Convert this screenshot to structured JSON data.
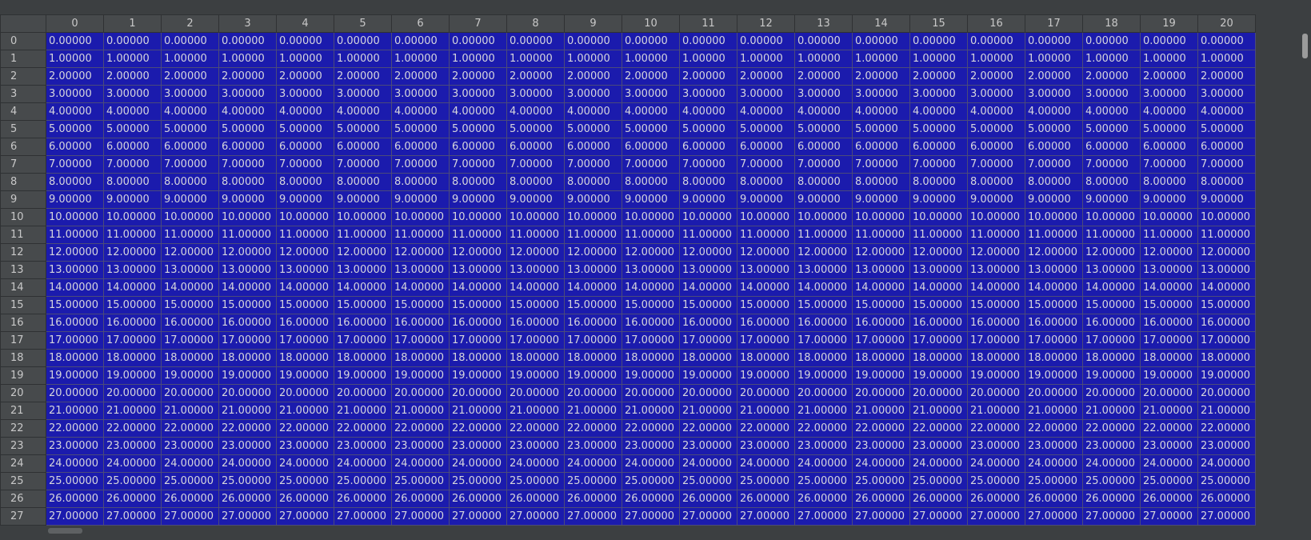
{
  "table": {
    "columns": [
      "0",
      "1",
      "2",
      "3",
      "4",
      "5",
      "6",
      "7",
      "8",
      "9",
      "10",
      "11",
      "12",
      "13",
      "14",
      "15",
      "16",
      "17",
      "18",
      "19",
      "20"
    ],
    "rows": [
      {
        "index": "0",
        "value": "0.00000"
      },
      {
        "index": "1",
        "value": "1.00000"
      },
      {
        "index": "2",
        "value": "2.00000"
      },
      {
        "index": "3",
        "value": "3.00000"
      },
      {
        "index": "4",
        "value": "4.00000"
      },
      {
        "index": "5",
        "value": "5.00000"
      },
      {
        "index": "6",
        "value": "6.00000"
      },
      {
        "index": "7",
        "value": "7.00000"
      },
      {
        "index": "8",
        "value": "8.00000"
      },
      {
        "index": "9",
        "value": "9.00000"
      },
      {
        "index": "10",
        "value": "10.00000"
      },
      {
        "index": "11",
        "value": "11.00000"
      },
      {
        "index": "12",
        "value": "12.00000"
      },
      {
        "index": "13",
        "value": "13.00000"
      },
      {
        "index": "14",
        "value": "14.00000"
      },
      {
        "index": "15",
        "value": "15.00000"
      },
      {
        "index": "16",
        "value": "16.00000"
      },
      {
        "index": "17",
        "value": "17.00000"
      },
      {
        "index": "18",
        "value": "18.00000"
      },
      {
        "index": "19",
        "value": "19.00000"
      },
      {
        "index": "20",
        "value": "20.00000"
      },
      {
        "index": "21",
        "value": "21.00000"
      },
      {
        "index": "22",
        "value": "22.00000"
      },
      {
        "index": "23",
        "value": "23.00000"
      },
      {
        "index": "24",
        "value": "24.00000"
      },
      {
        "index": "25",
        "value": "25.00000"
      },
      {
        "index": "26",
        "value": "26.00000"
      },
      {
        "index": "27",
        "value": "27.00000"
      }
    ]
  },
  "colors": {
    "cell_background": "#1b1bad",
    "cell_text": "#d6d6dc",
    "header_background": "#474a4c",
    "header_text": "#c8c8c8",
    "chrome_background": "#3c3f41"
  }
}
